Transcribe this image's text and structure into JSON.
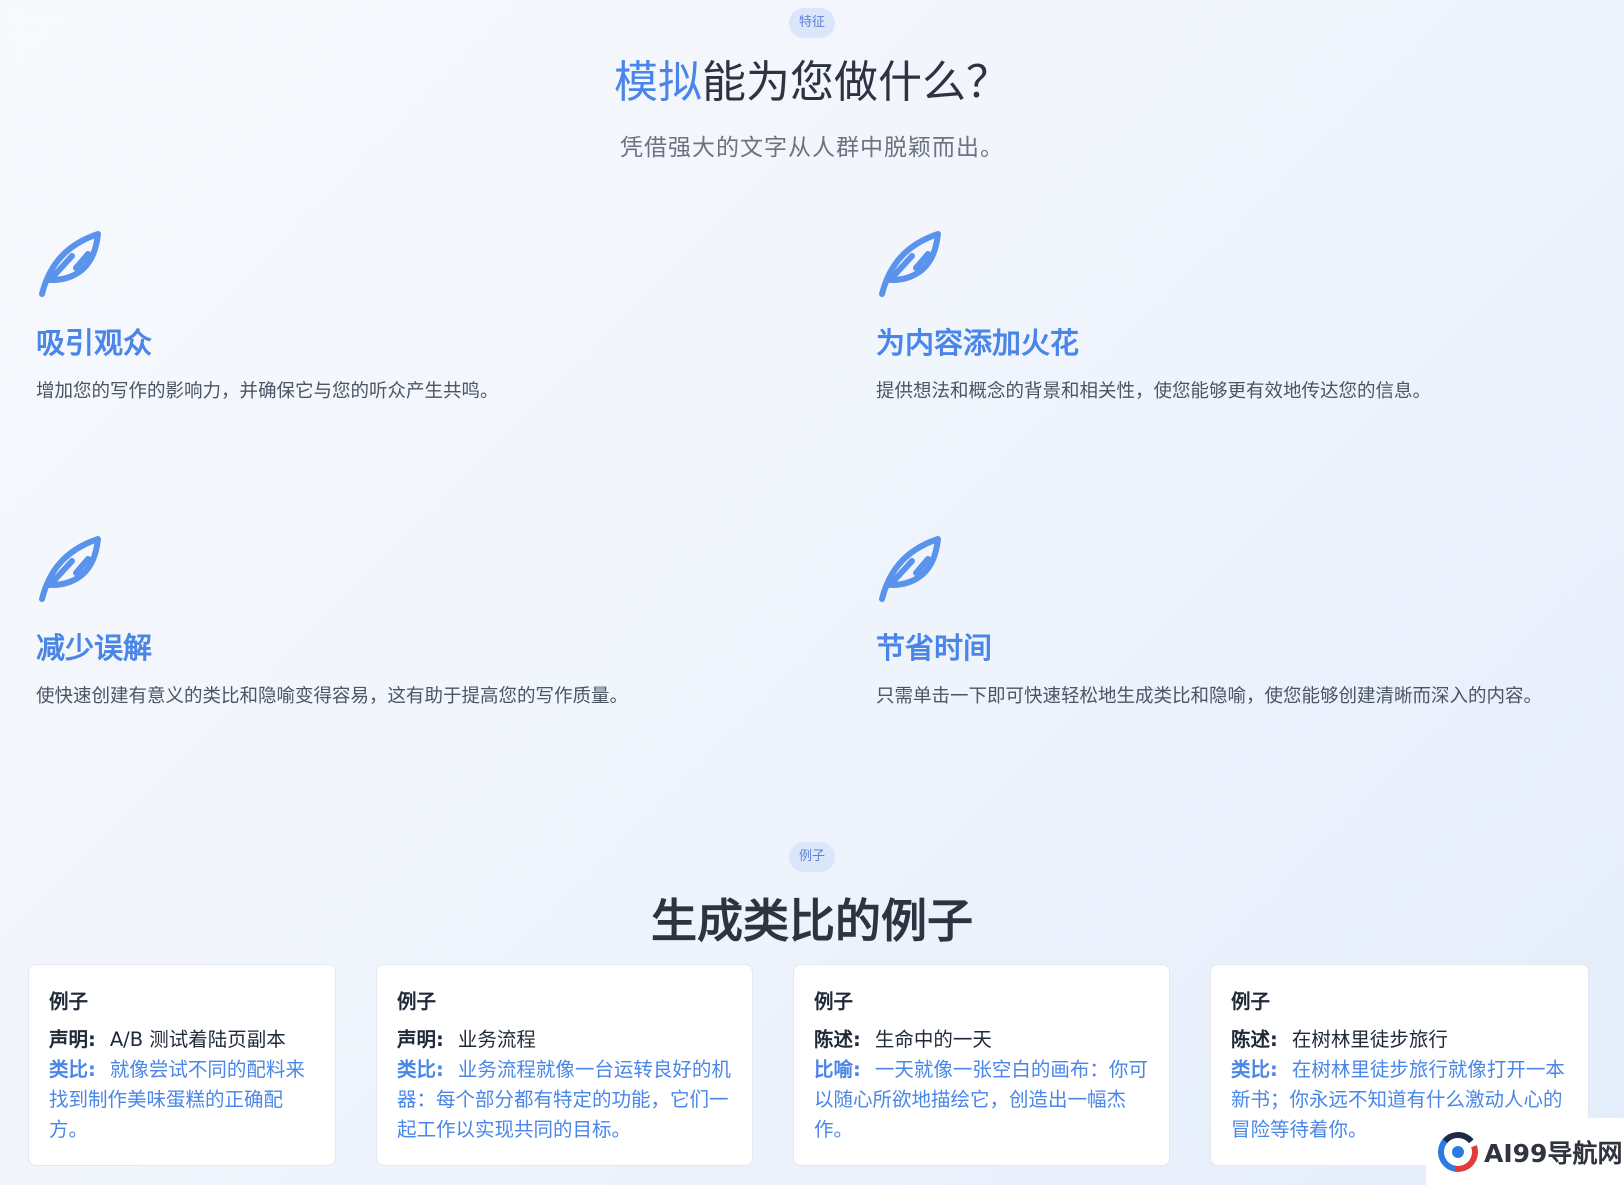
{
  "features_section": {
    "badge": "特征",
    "title_accent": "模拟",
    "title_rest": "能为您做什么？",
    "subtitle": "凭借强大的文字从人群中脱颖而出。",
    "icon": "feather-icon",
    "items": [
      {
        "title": "吸引观众",
        "description": "增加您的写作的影响力，并确保它与您的听众产生共鸣。"
      },
      {
        "title": "为内容添加火花",
        "description": "提供想法和概念的背景和相关性，使您能够更有效地传达您的信息。"
      },
      {
        "title": "减少误解",
        "description": "使快速创建有意义的类比和隐喻变得容易，这有助于提高您的写作质量。"
      },
      {
        "title": "节省时间",
        "description": "只需单击一下即可快速轻松地生成类比和隐喻，使您能够创建清晰而深入的内容。"
      }
    ]
  },
  "examples_section": {
    "badge": "例子",
    "title": "生成类比的例子",
    "cards": [
      {
        "heading": "例子",
        "key1": "声明:",
        "val1": "A/B 测试着陆页副本",
        "key2": "类比:",
        "val2": "就像尝试不同的配料来找到制作美味蛋糕的正确配方。"
      },
      {
        "heading": "例子",
        "key1": "声明:",
        "val1": "业务流程",
        "key2": "类比:",
        "val2": "业务流程就像一台运转良好的机器：每个部分都有特定的功能，它们一起工作以实现共同的目标。"
      },
      {
        "heading": "例子",
        "key1": "陈述:",
        "val1": "生命中的一天",
        "key2": "比喻:",
        "val2": "一天就像一张空白的画布：你可以随心所欲地描绘它，创造出一幅杰作。"
      },
      {
        "heading": "例子",
        "key1": "陈述:",
        "val1": "在树林里徒步旅行",
        "key2": "类比:",
        "val2": "在树林里徒步旅行就像打开一本新书；你永远不知道有什么激动人心的冒险等待着你。"
      }
    ]
  },
  "watermark": {
    "text": "AI99导航网"
  },
  "colors": {
    "accent": "#4a86e8",
    "badge_bg": "#dbe6fb",
    "heading": "#2d3340"
  }
}
